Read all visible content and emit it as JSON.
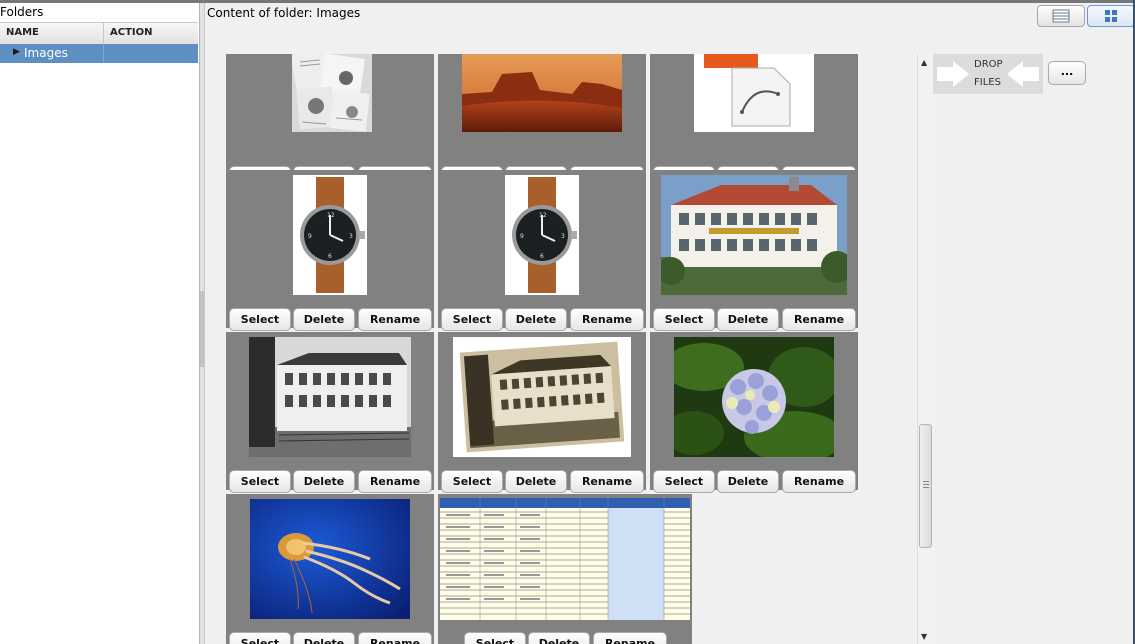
{
  "folders_panel": {
    "title": "Folders",
    "columns": [
      "NAME",
      "ACTION"
    ],
    "rows": [
      {
        "name": "Images"
      }
    ]
  },
  "content": {
    "title": "Content of folder: Images"
  },
  "view_buttons": [
    {
      "icon": "list-view-icon"
    },
    {
      "icon": "grid-view-icon"
    }
  ],
  "tile_buttons": {
    "select": "Select",
    "delete": "Delete",
    "rename": "Rename"
  },
  "tiles": [
    {
      "image": "watch-collage-thumbnail"
    },
    {
      "image": "desert-butte-thumbnail"
    },
    {
      "image": "eps-file-icon-thumbnail"
    },
    {
      "image": "watch-thumbnail"
    },
    {
      "image": "watch-thumbnail"
    },
    {
      "image": "factory-building-color-thumbnail"
    },
    {
      "image": "factory-building-bw-thumbnail"
    },
    {
      "image": "factory-building-sepia-thumbnail"
    },
    {
      "image": "hydrangea-flower-thumbnail"
    },
    {
      "image": "jellyfish-thumbnail"
    },
    {
      "image": "spreadsheet-thumbnail"
    }
  ],
  "drop_zone": {
    "line1": "DROP",
    "line2": "FILES"
  },
  "more_button": {
    "label": "..."
  },
  "scrollbar": {
    "up_icon": "scroll-up-arrow-icon",
    "down_icon": "scroll-down-arrow-icon"
  }
}
